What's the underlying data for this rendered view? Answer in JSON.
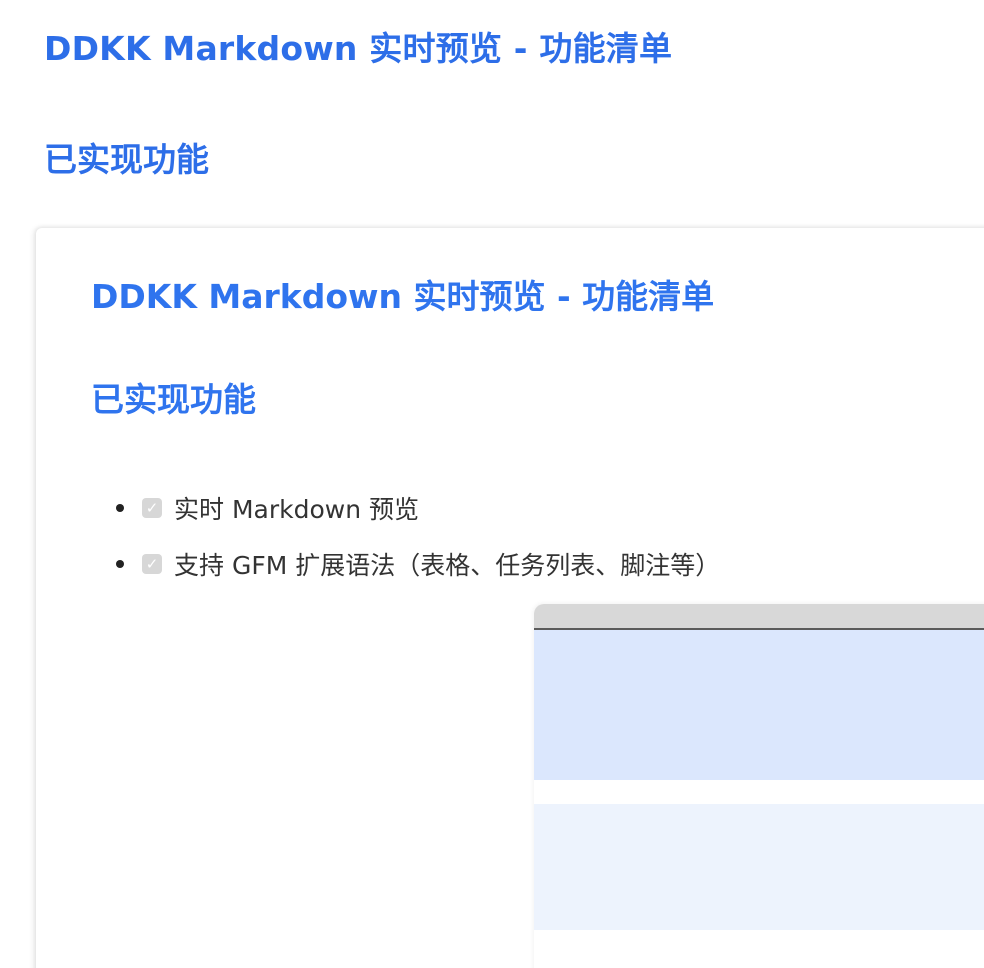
{
  "document": {
    "title": "DDKK Markdown 实时预览 - 功能清单",
    "section": "已实现功能"
  },
  "preview": {
    "title": "DDKK Markdown 实时预览 - 功能清单",
    "section": "已实现功能",
    "features": [
      {
        "label": "实时 Markdown 预览",
        "checked": true
      },
      {
        "label": "支持 GFM 扩展语法（表格、任务列表、脚注等）",
        "checked": true
      }
    ]
  },
  "icons": {
    "bullet": "bullet-icon",
    "checkbox": "checkbox-icon"
  },
  "colors": {
    "heading": "#2d6ee8",
    "inner_heading": "#2f74ee",
    "body_text": "#333333",
    "checkbox": "#d7d7d7",
    "nested_blue": "#dbe7fd",
    "nested_light": "#edf3fd",
    "nested_titlebar": "#d8d8d8"
  }
}
